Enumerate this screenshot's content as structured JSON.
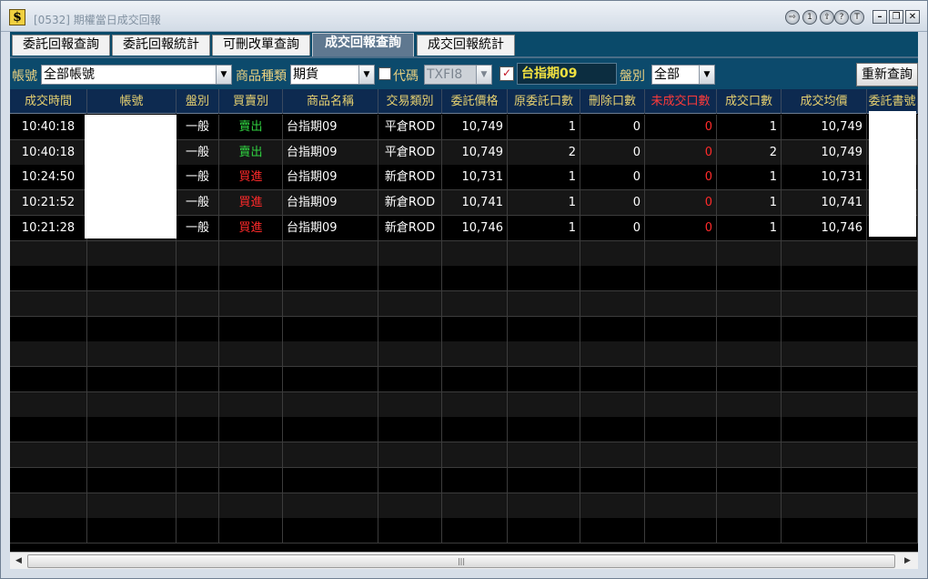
{
  "window": {
    "app_icon": "$",
    "title": "[0532] 期權當日成交回報",
    "buttons": [
      "⇨",
      "1",
      "⇪",
      "?",
      "T"
    ],
    "controls": {
      "minimize": "–",
      "maximize": "❐",
      "close": "✕"
    }
  },
  "tabs": [
    {
      "label": "委託回報查詢",
      "active": false
    },
    {
      "label": "委託回報統計",
      "active": false
    },
    {
      "label": "可刪改單查詢",
      "active": false
    },
    {
      "label": "成交回報查詢",
      "active": true
    },
    {
      "label": "成交回報統計",
      "active": false
    }
  ],
  "toolbar": {
    "account_label": "帳號",
    "account_value": "全部帳號",
    "product_type_label": "商品種類",
    "product_type_value": "期貨",
    "code_checked": false,
    "code_label": "代碼",
    "code_value": "TXFI8",
    "name_checked": true,
    "name_check_mark": "✓",
    "product_name": "台指期09",
    "session_label": "盤別",
    "session_value": "全部",
    "requery_label": "重新查詢",
    "dropdown_glyph": "▼"
  },
  "table": {
    "headers": [
      "成交時間",
      "帳號",
      "盤別",
      "買賣別",
      "商品名稱",
      "交易類別",
      "委託價格",
      "原委託口數",
      "刪除口數",
      "未成交口數",
      "成交口數",
      "成交均價",
      "委託書號"
    ],
    "rows": [
      {
        "time": "10:40:18",
        "session": "一般",
        "side": "賣出",
        "side_color": "green",
        "product": "台指期09",
        "trade_type": "平倉ROD",
        "price": "10,749",
        "orig_qty": "1",
        "cancel_qty": "0",
        "unfilled_qty": "0",
        "filled_qty": "1",
        "avg_price": "10,749"
      },
      {
        "time": "10:40:18",
        "session": "一般",
        "side": "賣出",
        "side_color": "green",
        "product": "台指期09",
        "trade_type": "平倉ROD",
        "price": "10,749",
        "orig_qty": "2",
        "cancel_qty": "0",
        "unfilled_qty": "0",
        "filled_qty": "2",
        "avg_price": "10,749"
      },
      {
        "time": "10:24:50",
        "session": "一般",
        "side": "買進",
        "side_color": "red",
        "product": "台指期09",
        "trade_type": "新倉ROD",
        "price": "10,731",
        "orig_qty": "1",
        "cancel_qty": "0",
        "unfilled_qty": "0",
        "filled_qty": "1",
        "avg_price": "10,731"
      },
      {
        "time": "10:21:52",
        "session": "一般",
        "side": "買進",
        "side_color": "red",
        "product": "台指期09",
        "trade_type": "新倉ROD",
        "price": "10,741",
        "orig_qty": "1",
        "cancel_qty": "0",
        "unfilled_qty": "0",
        "filled_qty": "1",
        "avg_price": "10,741"
      },
      {
        "time": "10:21:28",
        "session": "一般",
        "side": "買進",
        "side_color": "red",
        "product": "台指期09",
        "trade_type": "新倉ROD",
        "price": "10,746",
        "orig_qty": "1",
        "cancel_qty": "0",
        "unfilled_qty": "0",
        "filled_qty": "1",
        "avg_price": "10,746"
      }
    ]
  },
  "scrollbar": {
    "left": "◀",
    "right": "▶",
    "grip": "|||"
  }
}
